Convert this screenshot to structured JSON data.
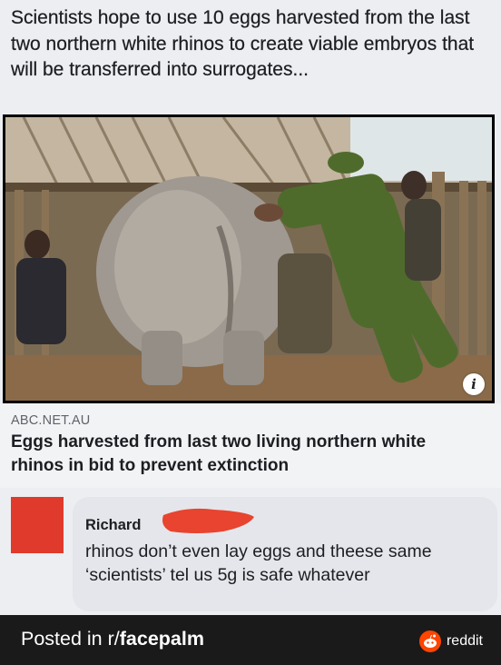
{
  "headline": "Scientists hope to use 10 eggs harvested from the last two northern white rhinos to create viable embryos that will be transferred into surrogates...",
  "link_card": {
    "domain": "ABC.NET.AU",
    "title": "Eggs harvested from last two living northern white rhinos in bid to prevent extinction",
    "info_icon": "i"
  },
  "comment": {
    "author": "Richard",
    "text": "rhinos don’t even lay eggs and theese same ‘scientists’ tel us 5g is safe whatever",
    "avatar_color": "#e03a2c",
    "redaction_color": "#e8442f"
  },
  "footer": {
    "prefix": "Posted in r/",
    "subreddit": "facepalm",
    "brand": "reddit",
    "brand_color": "#ff4500"
  }
}
